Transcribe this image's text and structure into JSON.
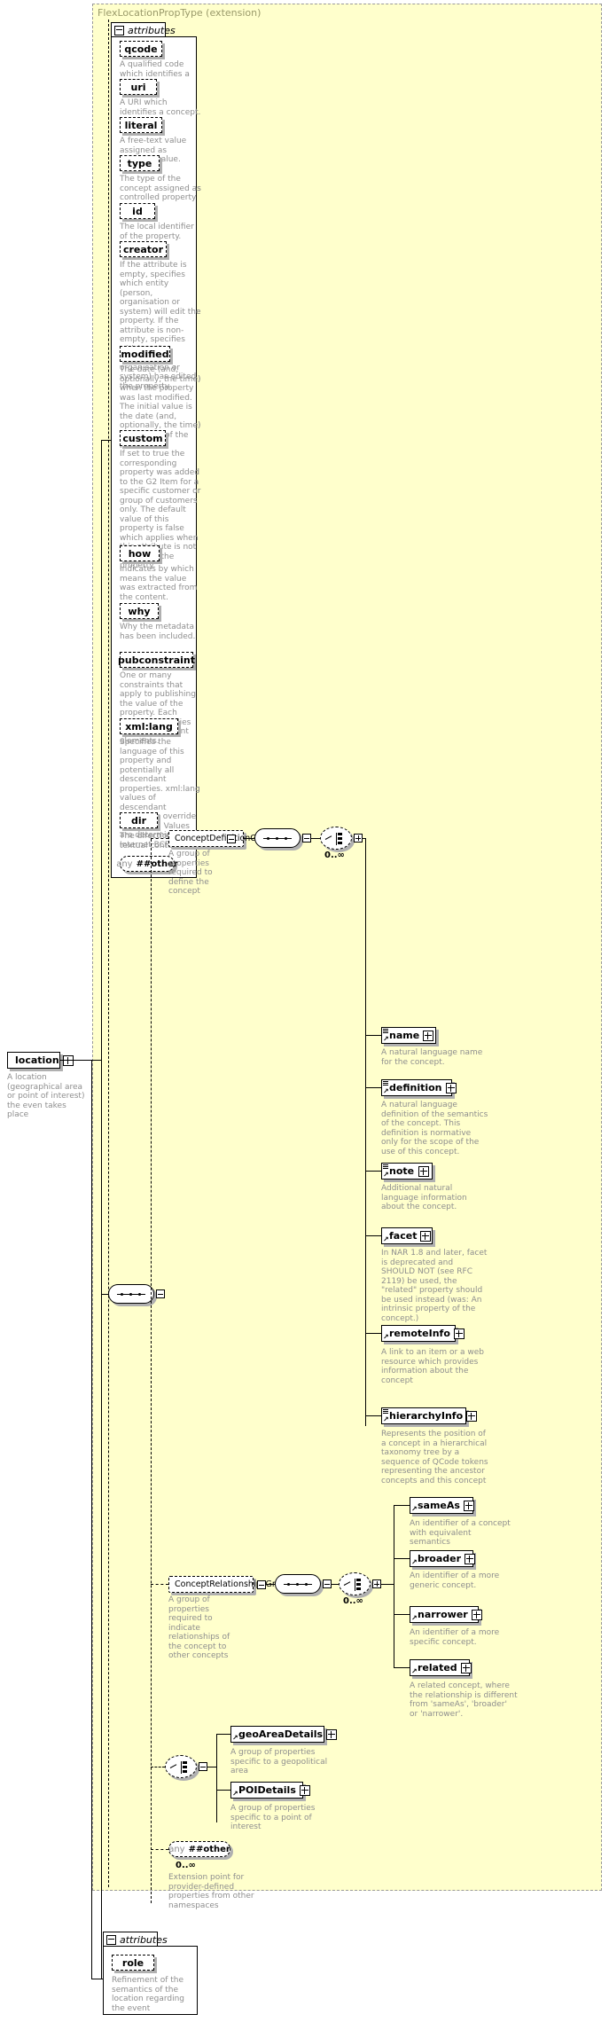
{
  "diagram": {
    "type_title": "FlexLocationPropType (extension)",
    "root_element": {
      "name": "location",
      "doc": "A location (geographical area or point of interest) the even takes place"
    },
    "attributes_label": "attributes",
    "any_label_prefix": "any",
    "any_label_name": "##other",
    "multiplicity_zero_unbounded": "0..∞"
  },
  "attributes_panel": {
    "title": "attributes",
    "items": [
      {
        "name": "qcode",
        "doc": "A qualified code which identifies a concept."
      },
      {
        "name": "uri",
        "doc": "A URI which identifies a concept."
      },
      {
        "name": "literal",
        "doc": "A free-text value assigned as property value."
      },
      {
        "name": "type",
        "doc": "The type of the concept assigned as controlled property value."
      },
      {
        "name": "id",
        "doc": "The local identifier of the property."
      },
      {
        "name": "creator",
        "doc": "If the attribute is empty, specifies which entity (person, organisation or system) will edit the property. If the attribute is non-empty, specifies which entity (person, organisation or system) has edited the property."
      },
      {
        "name": "modified",
        "doc": "The date (and, optionally, the time) when the property was last modified. The initial value is the date (and, optionally, the time) of creation of the property."
      },
      {
        "name": "custom",
        "doc": "If set to true the corresponding property was added to the G2 Item for a specific customer or group of customers only. The default value of this property is false which applies when this attribute is not used with the property."
      },
      {
        "name": "how",
        "doc": "Indicates by which means the value was extracted from the content."
      },
      {
        "name": "why",
        "doc": "Why the metadata has been included."
      },
      {
        "name": "pubconstraint",
        "doc": "One or many constraints that apply to publishing the value of the property. Each constraint applies to all descendant elements."
      },
      {
        "name": "xml:lang",
        "doc": "Specifies the language of this property and potentially all descendant properties. xml:lang values of descendant properties override this value. Values are determined by Internet BCP 47."
      },
      {
        "name": "dir",
        "doc": "The directionality of textual content."
      }
    ],
    "any_prefix": "any",
    "any_name": "##other"
  },
  "concept_definition_group": {
    "name": "ConceptDefinitionGroup",
    "doc": "A group of properties required to define the concept",
    "multiplicity": "0..∞",
    "elements": [
      {
        "name": "name",
        "doc": "A natural language name for the concept."
      },
      {
        "name": "definition",
        "doc": "A natural language definition of the semantics of the concept. This definition is normative only for the scope of the use of this concept."
      },
      {
        "name": "note",
        "doc": "Additional natural language information about the concept."
      },
      {
        "name": "facet",
        "doc": "In NAR 1.8 and later, facet is deprecated and SHOULD NOT (see RFC 2119) be used, the \"related\" property should be used instead (was: An intrinsic property of the concept.)"
      },
      {
        "name": "remoteInfo",
        "doc": "A link to an item or a web resource which provides information about the concept"
      },
      {
        "name": "hierarchyInfo",
        "doc": "Represents the position of a concept in a hierarchical taxonomy tree by a sequence of QCode tokens representing the ancestor concepts and this concept"
      }
    ]
  },
  "concept_relationships_group": {
    "name": "ConceptRelationshipsGroup",
    "doc": "A group of properties required to indicate relationships of the concept to other concepts",
    "multiplicity": "0..∞",
    "elements": [
      {
        "name": "sameAs",
        "doc": "An identifier of a concept with equivalent semantics"
      },
      {
        "name": "broader",
        "doc": "An identifier of a more generic concept."
      },
      {
        "name": "narrower",
        "doc": "An identifier of a more specific concept."
      },
      {
        "name": "related",
        "doc": "A related concept, where the relationship is different from 'sameAs', 'broader' or 'narrower'."
      }
    ]
  },
  "details_choice": {
    "elements": [
      {
        "name": "geoAreaDetails",
        "doc": "A group of properties specific to a geopolitical area"
      },
      {
        "name": "POIDetails",
        "doc": "A group of properties specific to a point of interest"
      }
    ]
  },
  "extension_any": {
    "prefix": "any",
    "name": "##other",
    "multiplicity": "0..∞",
    "doc": "Extension point for provider-defined properties from other namespaces"
  },
  "bottom_attributes_panel": {
    "title": "attributes",
    "items": [
      {
        "name": "role",
        "doc": "Refinement of the semantics of the location regarding the event"
      }
    ]
  },
  "colors": {
    "extension_bg": "#ffffcc",
    "extension_border": "#999999",
    "doc_text": "#8e8e8e",
    "title_text": "#9a9a6a",
    "shadow": "#b0b0b0"
  }
}
